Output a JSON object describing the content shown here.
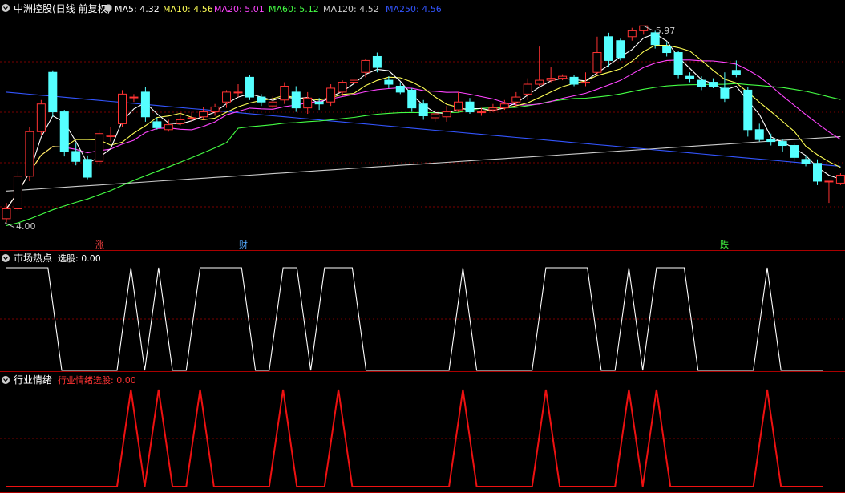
{
  "header": {
    "title": "中洲控股(日线 前复权)",
    "ma": [
      {
        "name": "MA5",
        "text": "MA5: 4.32",
        "color": "#ffffff"
      },
      {
        "name": "MA10",
        "text": "MA10: 4.56",
        "color": "#ffff55"
      },
      {
        "name": "MA20",
        "text": "MA20: 5.01",
        "color": "#ff44ff"
      },
      {
        "name": "MA60",
        "text": "MA60: 5.12",
        "color": "#44ff44"
      },
      {
        "name": "MA120",
        "text": "MA120: 4.52",
        "color": "#cccccc"
      },
      {
        "name": "MA250",
        "text": "MA250: 4.56",
        "color": "#3355ff"
      }
    ]
  },
  "annotations": {
    "high_label": "5.97",
    "low_label": "4.00",
    "marker_rise": "涨",
    "marker_finance": "财",
    "marker_fall": "跌"
  },
  "panel2": {
    "title": "市场热点",
    "label": "选股: 0.00"
  },
  "panel3": {
    "title": "行业情绪",
    "label": "行业情绪选股: 0.00"
  },
  "colors": {
    "up": "#ff3333",
    "down": "#55ffff",
    "grid": "#7a0000",
    "border": "#aa0000",
    "signal1": "#ffffff",
    "signal2": "#ee1111"
  },
  "chart_data": {
    "type": "candlestick",
    "ylim": [
      3.8,
      6.15
    ],
    "candles": [
      [
        4.02,
        4.12,
        4.18,
        3.98
      ],
      [
        4.12,
        4.45,
        4.5,
        4.1
      ],
      [
        4.45,
        4.9,
        4.95,
        4.4
      ],
      [
        4.9,
        5.18,
        5.22,
        4.86
      ],
      [
        5.5,
        5.1,
        5.52,
        5.05
      ],
      [
        5.1,
        4.7,
        5.12,
        4.65
      ],
      [
        4.7,
        4.6,
        4.78,
        4.56
      ],
      [
        4.62,
        4.44,
        4.66,
        4.42
      ],
      [
        4.6,
        4.88,
        4.92,
        4.55
      ],
      [
        4.85,
        4.86,
        4.95,
        4.8
      ],
      [
        4.98,
        5.28,
        5.32,
        4.95
      ],
      [
        5.25,
        5.25,
        5.28,
        5.2
      ],
      [
        5.3,
        5.05,
        5.35,
        5.0
      ],
      [
        5.0,
        4.94,
        5.04,
        4.92
      ],
      [
        4.92,
        4.97,
        5.02,
        4.9
      ],
      [
        4.98,
        5.02,
        5.1,
        4.96
      ],
      [
        5.04,
        5.04,
        5.1,
        5.0
      ],
      [
        5.05,
        5.1,
        5.15,
        5.02
      ],
      [
        5.1,
        5.15,
        5.18,
        5.06
      ],
      [
        5.2,
        5.3,
        5.32,
        5.14
      ],
      [
        5.3,
        5.3,
        5.38,
        5.25
      ],
      [
        5.45,
        5.25,
        5.47,
        5.22
      ],
      [
        5.25,
        5.2,
        5.28,
        5.16
      ],
      [
        5.16,
        5.2,
        5.26,
        5.12
      ],
      [
        5.22,
        5.36,
        5.4,
        5.18
      ],
      [
        5.3,
        5.14,
        5.36,
        5.1
      ],
      [
        5.14,
        5.24,
        5.3,
        5.08
      ],
      [
        5.2,
        5.18,
        5.24,
        5.12
      ],
      [
        5.2,
        5.34,
        5.38,
        5.16
      ],
      [
        5.3,
        5.4,
        5.42,
        5.26
      ],
      [
        5.4,
        5.42,
        5.5,
        5.36
      ],
      [
        5.5,
        5.62,
        5.64,
        5.45
      ],
      [
        5.66,
        5.55,
        5.7,
        5.5
      ],
      [
        5.42,
        5.38,
        5.46,
        5.34
      ],
      [
        5.36,
        5.3,
        5.4,
        5.28
      ],
      [
        5.32,
        5.14,
        5.34,
        5.1
      ],
      [
        5.18,
        5.06,
        5.22,
        5.02
      ],
      [
        5.04,
        5.08,
        5.12,
        5.0
      ],
      [
        5.05,
        5.1,
        5.16,
        5.0
      ],
      [
        5.12,
        5.2,
        5.3,
        5.1
      ],
      [
        5.2,
        5.1,
        5.24,
        5.08
      ],
      [
        5.1,
        5.1,
        5.14,
        5.06
      ],
      [
        5.12,
        5.14,
        5.18,
        5.1
      ],
      [
        5.14,
        5.18,
        5.22,
        5.12
      ],
      [
        5.2,
        5.25,
        5.3,
        5.16
      ],
      [
        5.28,
        5.38,
        5.44,
        5.22
      ],
      [
        5.38,
        5.42,
        5.76,
        5.36
      ],
      [
        5.42,
        5.44,
        5.55,
        5.4
      ],
      [
        5.44,
        5.46,
        5.48,
        5.42
      ],
      [
        5.45,
        5.38,
        5.47,
        5.36
      ],
      [
        5.4,
        5.4,
        5.5,
        5.36
      ],
      [
        5.5,
        5.7,
        5.86,
        5.48
      ],
      [
        5.86,
        5.62,
        5.9,
        5.55
      ],
      [
        5.82,
        5.65,
        5.84,
        5.62
      ],
      [
        5.86,
        5.92,
        5.95,
        5.82
      ],
      [
        5.92,
        5.97,
        5.97,
        5.88
      ],
      [
        5.9,
        5.78,
        5.92,
        5.74
      ],
      [
        5.76,
        5.7,
        5.8,
        5.66
      ],
      [
        5.7,
        5.48,
        5.72,
        5.44
      ],
      [
        5.46,
        5.44,
        5.5,
        5.4
      ],
      [
        5.42,
        5.36,
        5.46,
        5.32
      ],
      [
        5.4,
        5.36,
        5.44,
        5.34
      ],
      [
        5.34,
        5.24,
        5.5,
        5.2
      ],
      [
        5.52,
        5.48,
        5.62,
        5.45
      ],
      [
        5.32,
        4.92,
        5.35,
        4.85
      ],
      [
        4.92,
        4.82,
        4.98,
        4.8
      ],
      [
        4.82,
        4.8,
        4.88,
        4.76
      ],
      [
        4.8,
        4.76,
        4.82,
        4.7
      ],
      [
        4.76,
        4.64,
        4.78,
        4.6
      ],
      [
        4.62,
        4.58,
        4.66,
        4.55
      ],
      [
        4.58,
        4.4,
        4.62,
        4.36
      ],
      [
        4.4,
        4.4,
        4.4,
        4.18
      ],
      [
        4.38,
        4.46,
        4.48,
        4.36
      ]
    ],
    "signal1": [
      1,
      1,
      1,
      1,
      0,
      0,
      0,
      0,
      0,
      1,
      0,
      1,
      0,
      0,
      1,
      1,
      1,
      1,
      0,
      0,
      1,
      1,
      0,
      1,
      1,
      1,
      0,
      0,
      0,
      0,
      0,
      0,
      0,
      1,
      0,
      0,
      0,
      0,
      0,
      1,
      1,
      1,
      1,
      0,
      0,
      1,
      0,
      1,
      1,
      1,
      0,
      0,
      0,
      0,
      0,
      1,
      0,
      0,
      0,
      0
    ],
    "signal2": [
      0,
      0,
      0,
      0,
      0,
      0,
      0,
      0,
      0,
      1,
      0,
      1,
      0,
      0,
      1,
      0,
      0,
      0,
      0,
      0,
      1,
      0,
      0,
      0,
      1,
      0,
      0,
      0,
      0,
      0,
      0,
      0,
      0,
      1,
      0,
      0,
      0,
      0,
      0,
      1,
      0,
      0,
      0,
      0,
      0,
      1,
      0,
      1,
      0,
      0,
      0,
      0,
      0,
      0,
      0,
      1,
      0,
      0,
      0,
      0
    ]
  }
}
